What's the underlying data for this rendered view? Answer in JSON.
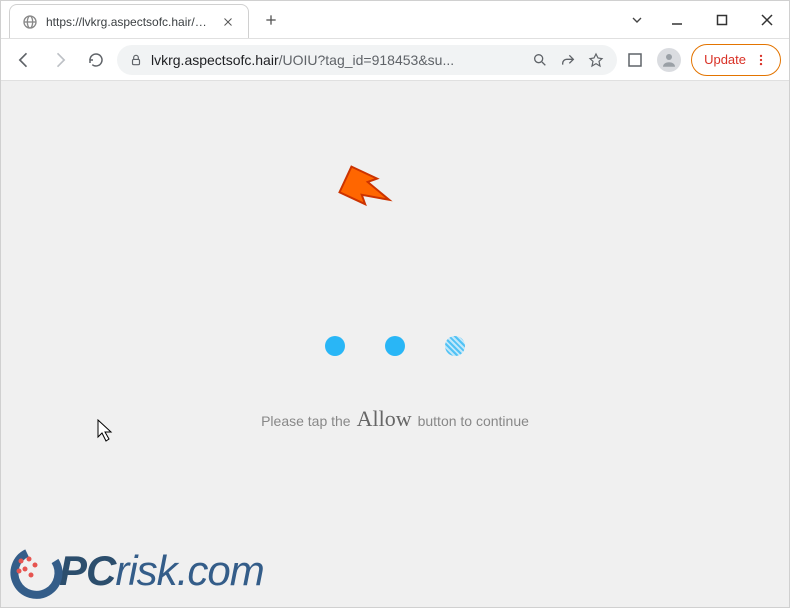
{
  "window": {
    "tab_title": "https://lvkrg.aspectsofc.hair/UOIU"
  },
  "toolbar": {
    "url_host": "lvkrg.aspectsofc.hair",
    "url_path": "/UOIU?tag_id=918453&su...",
    "update_label": "Update"
  },
  "page": {
    "instruction_pre": "Please tap the",
    "instruction_word": "Allow",
    "instruction_post": "button to continue"
  },
  "watermark": {
    "text_part1": "PC",
    "text_part2": "risk",
    "text_part3": ".com"
  }
}
